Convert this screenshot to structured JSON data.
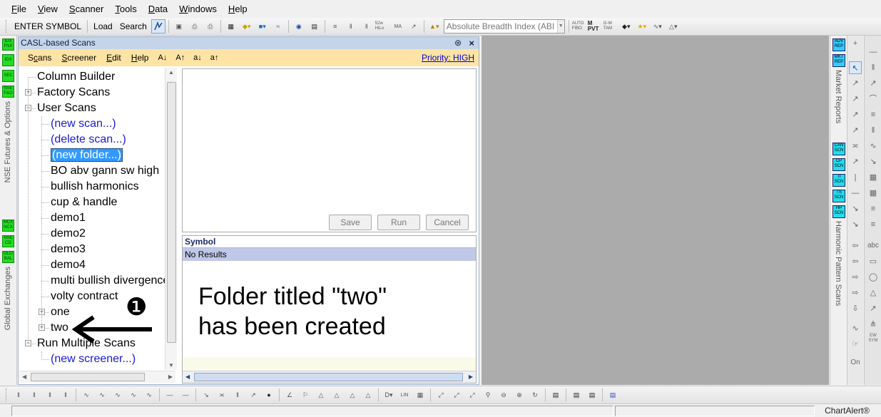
{
  "menu": [
    "File",
    "View",
    "Scanner",
    "Tools",
    "Data",
    "Windows",
    "Help"
  ],
  "menu_underline": [
    "F",
    "V",
    "S",
    "T",
    "D",
    "W",
    "H"
  ],
  "toolbar": {
    "enter_symbol": "ENTER SYMBOL",
    "load": "Load",
    "search": "Search",
    "indicator_combo": "Absolute Breadth Index (ABI",
    "icon_labels": [
      "52w HiLo",
      "MA",
      "AUTO FIBO",
      "M PVT",
      "G-W TAM",
      "TAS"
    ]
  },
  "left_strip": {
    "buttons": [
      "IDX FNX",
      "IDX",
      "SEC",
      "NSE F&O",
      "MCX NCX",
      "NSE CD",
      "GLO BAL"
    ],
    "label_top": "NSE Futures & Options",
    "label_bottom": "Global Exchanges"
  },
  "panel": {
    "title": "CASL-based Scans",
    "pin_icon": "pin-icon",
    "menu": [
      "Scans",
      "Screener",
      "Edit",
      "Help"
    ],
    "menu_underline": [
      "c",
      "S",
      "E",
      "H"
    ],
    "font_buttons": [
      "A↓",
      "A↑",
      "a↓",
      "a↑"
    ],
    "priority": "Priority: HIGH",
    "tree": [
      {
        "label": "Column Builder",
        "level": 0,
        "blue": false
      },
      {
        "label": "Factory Scans",
        "level": 0,
        "blue": false,
        "expander": "+"
      },
      {
        "label": "User Scans",
        "level": 0,
        "blue": false,
        "expander": "−"
      },
      {
        "label": "(new scan...)",
        "level": 1,
        "blue": true
      },
      {
        "label": "(delete scan...)",
        "level": 1,
        "blue": true
      },
      {
        "label": "(new folder...)",
        "level": 1,
        "blue": true,
        "selected": true
      },
      {
        "label": "BO abv gann sw high",
        "level": 1,
        "blue": false
      },
      {
        "label": "bullish harmonics",
        "level": 1,
        "blue": false
      },
      {
        "label": "cup & handle",
        "level": 1,
        "blue": false
      },
      {
        "label": "demo1",
        "level": 1,
        "blue": false
      },
      {
        "label": "demo2",
        "level": 1,
        "blue": false
      },
      {
        "label": "demo3",
        "level": 1,
        "blue": false
      },
      {
        "label": "demo4",
        "level": 1,
        "blue": false
      },
      {
        "label": "multi bullish divergence",
        "level": 1,
        "blue": false
      },
      {
        "label": "volty contract",
        "level": 1,
        "blue": false
      },
      {
        "label": "one",
        "level": 1,
        "blue": false,
        "expander": "+"
      },
      {
        "label": "two",
        "level": 1,
        "blue": false,
        "expander": "+"
      },
      {
        "label": "Run Multiple Scans",
        "level": 0,
        "blue": false,
        "expander": "−"
      },
      {
        "label": "(new screener...)",
        "level": 1,
        "blue": true
      }
    ],
    "buttons": {
      "save": "Save",
      "run": "Run",
      "cancel": "Cancel"
    },
    "results": {
      "header": "Symbol",
      "empty": "No Results"
    }
  },
  "annotation": {
    "step": "❶",
    "note": "Folder titled \"two\"\nhas been created"
  },
  "right_strip": {
    "top_buttons": [
      "ADV REP",
      "MKT REP"
    ],
    "scan_buttons": [
      "CAN SCN",
      "CP SCN",
      "TI SCN",
      "TS SCN",
      "HP SCN"
    ],
    "label_top": "Market Reports",
    "label_bottom": "Harmonic Pattern Scans"
  },
  "drawing_tools": [
    "abc",
    "On",
    "EW SYM"
  ],
  "status": {
    "brand": "ChartAlert®"
  }
}
